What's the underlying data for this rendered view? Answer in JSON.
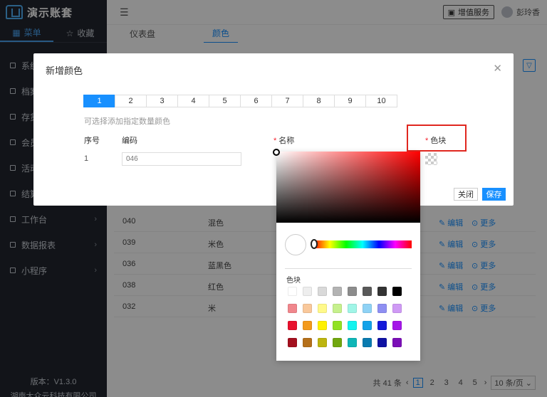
{
  "app": {
    "title": "演示账套"
  },
  "sidebar": {
    "tabs": [
      {
        "label": "菜单",
        "icon": "grid-icon"
      },
      {
        "label": "收藏",
        "icon": "star-icon"
      }
    ],
    "items": [
      {
        "label": "系统"
      },
      {
        "label": "档案"
      },
      {
        "label": "存货"
      },
      {
        "label": "会员"
      },
      {
        "label": "活动"
      },
      {
        "label": "结算"
      },
      {
        "label": "工作台"
      },
      {
        "label": "数据报表"
      },
      {
        "label": "小程序"
      }
    ],
    "version": "版本：V1.3.0",
    "company": "湖南大众云科技有限公司"
  },
  "header": {
    "vas_label": "增值服务",
    "user_name": "彭玲香"
  },
  "page_tabs": [
    {
      "label": "仪表盘"
    },
    {
      "label": "颜色"
    }
  ],
  "table": {
    "rows": [
      {
        "code": "040",
        "name": "混色"
      },
      {
        "code": "039",
        "name": "米色"
      },
      {
        "code": "036",
        "name": "蓝黑色"
      },
      {
        "code": "038",
        "name": "红色"
      },
      {
        "code": "032",
        "name": "米"
      }
    ],
    "edit_label": "编辑",
    "more_label": "更多"
  },
  "pager": {
    "total": "共 41 条",
    "pages": [
      "1",
      "2",
      "3",
      "4",
      "5"
    ],
    "current": "1",
    "size": "10 条/页"
  },
  "dialog": {
    "title": "新增颜色",
    "numbers": [
      "1",
      "2",
      "3",
      "4",
      "5",
      "6",
      "7",
      "8",
      "9",
      "10"
    ],
    "active_number": "1",
    "hint": "可选择添加指定数量颜色",
    "columns": {
      "no": "序号",
      "code": "编码",
      "name": "名称",
      "swatch": "色块"
    },
    "row": {
      "no": "1",
      "code_placeholder": "046"
    },
    "close_label": "关闭",
    "save_label": "保存"
  },
  "picker": {
    "swatch_label": "色块",
    "swatches": [
      [
        "#ffffff",
        "#eeeeee",
        "#d9d9d9",
        "#b3b3b3",
        "#8c8c8c",
        "#595959",
        "#333333",
        "#000000"
      ],
      [
        "#f0868c",
        "#f9c89b",
        "#fff98a",
        "#c6f08d",
        "#a0f5e7",
        "#8fd2f5",
        "#8e8ff2",
        "#cf9af5"
      ],
      [
        "#e8112d",
        "#f39a1c",
        "#fff000",
        "#92e124",
        "#13f3ef",
        "#13a2e9",
        "#1419d9",
        "#a416e8"
      ],
      [
        "#a3101e",
        "#b5701a",
        "#bdb50f",
        "#71a70f",
        "#0fb6b7",
        "#0a7bb0",
        "#0f12a3",
        "#7b0fb7"
      ]
    ],
    "accent": "#ff0000"
  }
}
